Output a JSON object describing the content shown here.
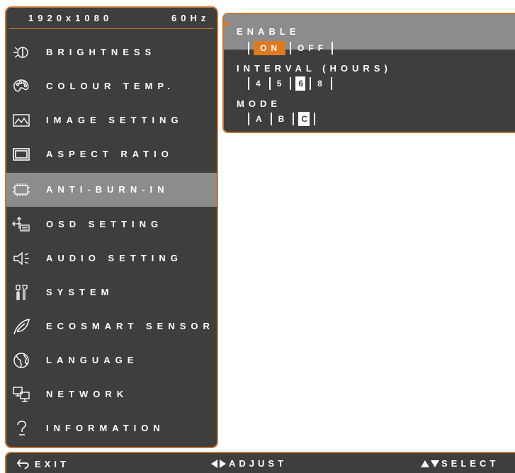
{
  "status": {
    "resolution": "1920x1080",
    "refresh": "60Hz"
  },
  "menu": {
    "items": [
      {
        "label": "BRIGHTNESS",
        "icon": "brightness-icon"
      },
      {
        "label": "COLOUR TEMP.",
        "icon": "palette-icon"
      },
      {
        "label": "IMAGE SETTING",
        "icon": "image-icon"
      },
      {
        "label": "ASPECT RATIO",
        "icon": "aspect-ratio-icon"
      },
      {
        "label": "ANTI-BURN-IN",
        "icon": "chip-icon",
        "active": true
      },
      {
        "label": "OSD SETTING",
        "icon": "osd-icon"
      },
      {
        "label": "AUDIO SETTING",
        "icon": "speaker-icon"
      },
      {
        "label": "SYSTEM",
        "icon": "tools-icon"
      },
      {
        "label": "ECOSMART SENSOR",
        "icon": "leaf-icon"
      },
      {
        "label": "LANGUAGE",
        "icon": "globe-icon"
      },
      {
        "label": "NETWORK",
        "icon": "network-icon"
      },
      {
        "label": "INFORMATION",
        "icon": "question-icon"
      }
    ]
  },
  "submenu": {
    "enable": {
      "label": "ENABLE",
      "options": [
        "ON",
        "OFF"
      ],
      "selected": "ON"
    },
    "interval": {
      "label": "INTERVAL (HOURS)",
      "options": [
        "4",
        "5",
        "6",
        "8"
      ],
      "selected": "6"
    },
    "mode": {
      "label": "MODE",
      "options": [
        "A",
        "B",
        "C"
      ],
      "selected": "C"
    }
  },
  "footer": {
    "exit": "EXIT",
    "adjust": "ADJUST",
    "select": "SELECT"
  },
  "colors": {
    "accent": "#e07a1f",
    "panel": "#3e3e3e",
    "highlight": "#8c8c8c"
  }
}
